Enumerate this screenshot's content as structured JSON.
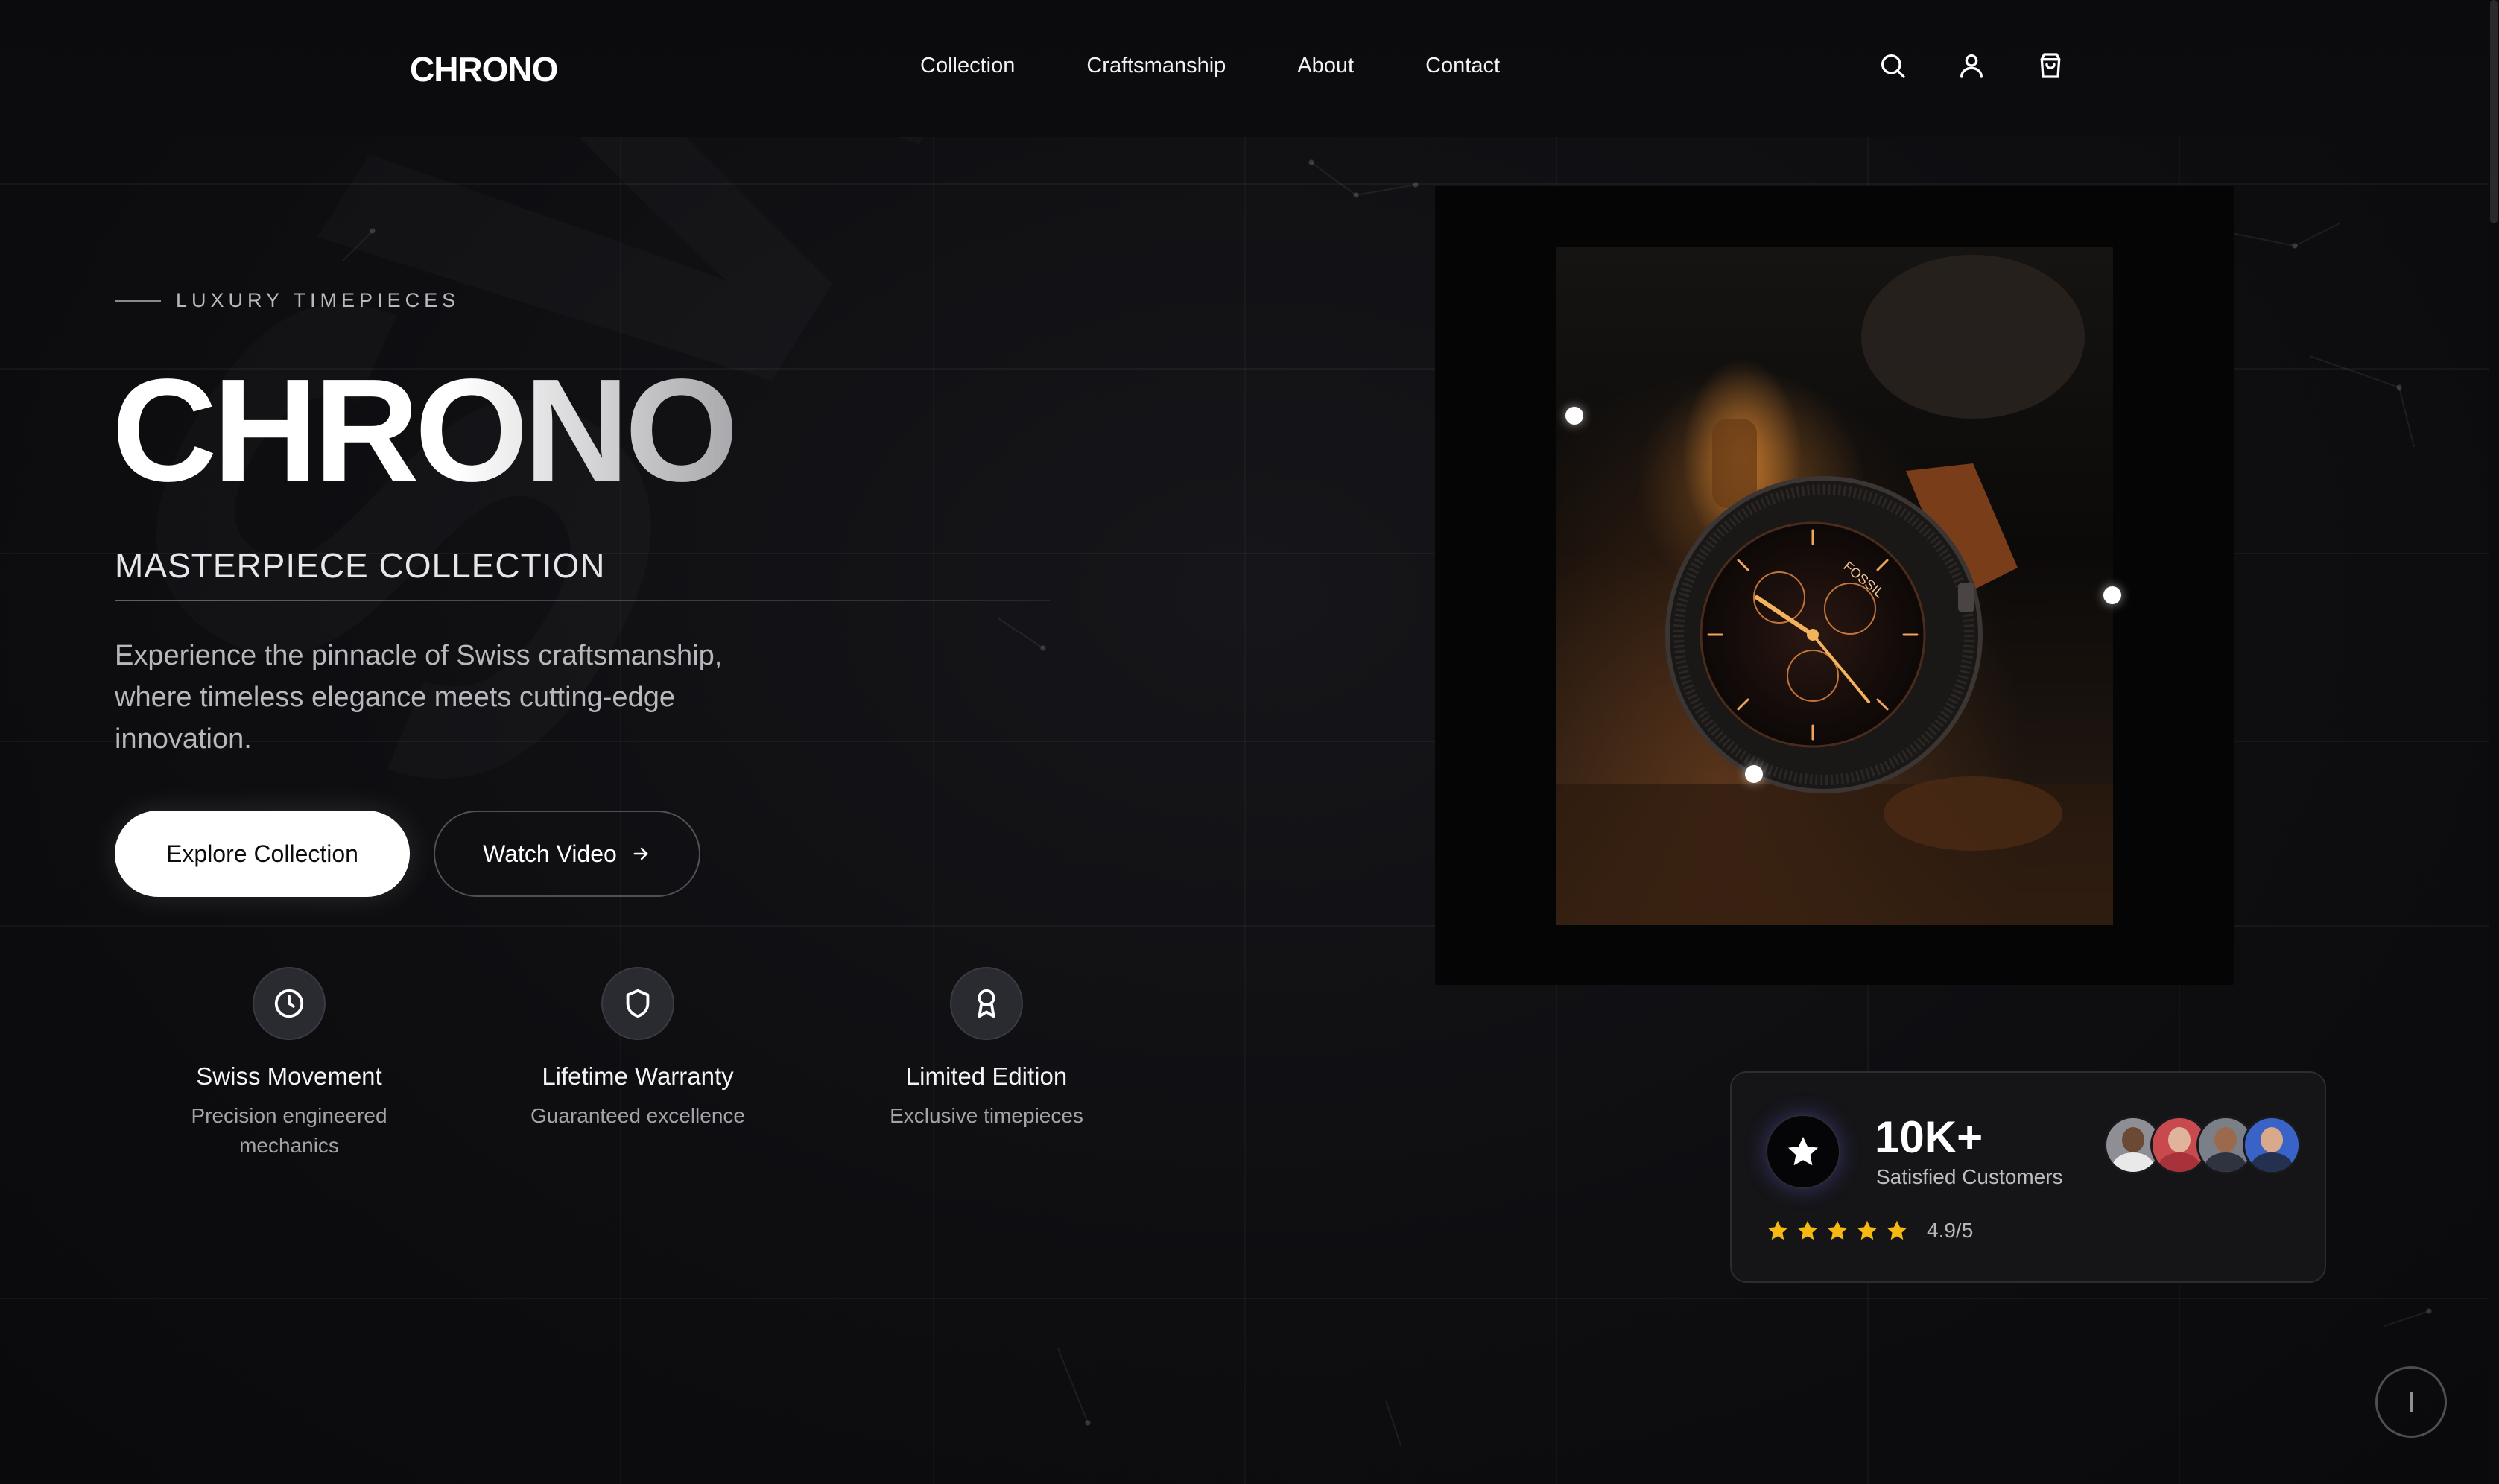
{
  "nav": {
    "brand": "CHRONO",
    "links": [
      "Collection",
      "Craftsmanship",
      "About",
      "Contact"
    ],
    "icons": [
      "search-icon",
      "user-icon",
      "shopping-bag-icon"
    ]
  },
  "hero": {
    "eyebrow": "LUXURY TIMEPIECES",
    "title": "CHRONO",
    "subtitle": "MASTERPIECE COLLECTION",
    "description": "Experience the pinnacle of Swiss craftsmanship, where timeless elegance meets cutting-edge innovation.",
    "primary_button": "Explore Collection",
    "secondary_button": "Watch Video",
    "background_word": "SWISS"
  },
  "features": [
    {
      "icon": "clock-icon",
      "title": "Swiss Movement",
      "desc": "Precision engineered mechanics"
    },
    {
      "icon": "shield-icon",
      "title": "Lifetime Warranty",
      "desc": "Guaranteed excellence"
    },
    {
      "icon": "award-icon",
      "title": "Limited Edition",
      "desc": "Exclusive timepieces"
    }
  ],
  "product_image": {
    "watch_brand_text": "FOSSIL"
  },
  "stats": {
    "count": "10K+",
    "label": "Satisfied Customers",
    "stars": 5,
    "rating": "4.9/5",
    "avatars": 4
  },
  "colors": {
    "background": "#0d0d10",
    "accent_star": "#f5b912",
    "text_primary": "#ffffff",
    "text_muted": "#b7b7bc"
  }
}
